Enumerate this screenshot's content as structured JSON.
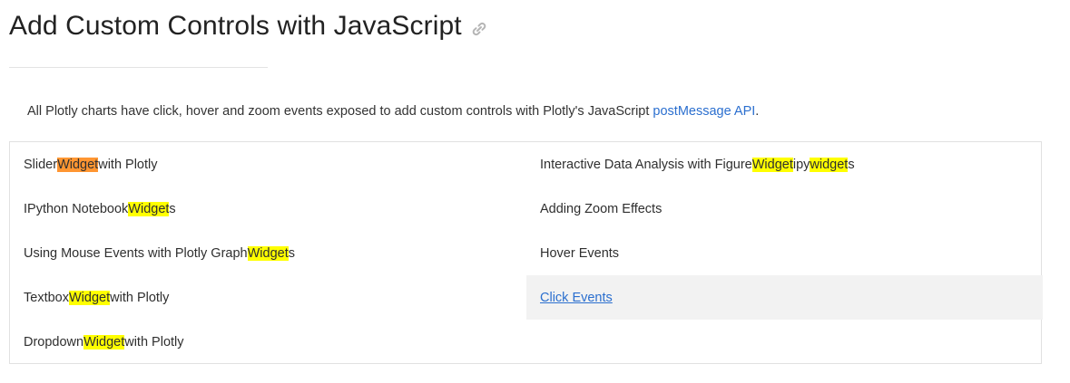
{
  "header": {
    "title": "Add Custom Controls with JavaScript"
  },
  "intro": {
    "text": "All Plotly charts have click, hover and zoom events exposed to add custom controls with Plotly's JavaScript ",
    "link": "postMessage API",
    "suffix": "."
  },
  "results": {
    "left": [
      {
        "pre": "Slider ",
        "hl": "Widget",
        "post": " with Plotly",
        "current": true
      },
      {
        "pre": "IPython Notebook ",
        "hl": "Widget",
        "post": "s"
      },
      {
        "pre": "Using Mouse Events with Plotly Graph",
        "hl": "Widget",
        "post": "s"
      },
      {
        "pre": "Textbox ",
        "hl": "Widget",
        "post": " with Plotly"
      },
      {
        "pre": "Dropdown ",
        "hl": "Widget",
        "post": " with Plotly"
      }
    ],
    "right": [
      {
        "pre": "Interactive Data Analysis with Figure",
        "hl": "Widget",
        "mid": " ipy",
        "hl2": "widget",
        "post": "s"
      },
      {
        "text": "Adding Zoom Effects"
      },
      {
        "text": "Hover Events"
      },
      {
        "text": "Click Events",
        "active": true
      }
    ]
  },
  "colors": {
    "highlight": "#ffff00",
    "current_highlight": "#ff9632",
    "link": "#2b6fcf"
  }
}
